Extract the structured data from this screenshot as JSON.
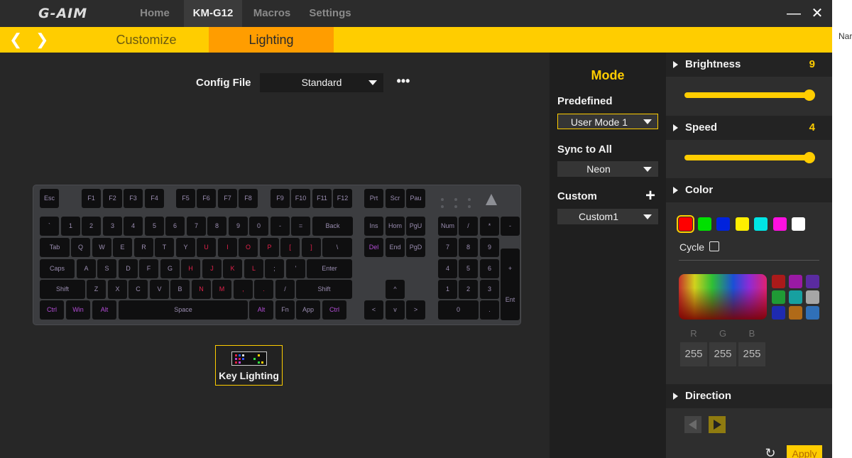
{
  "header": {
    "logo": "G-AIM",
    "nav": [
      {
        "label": "Home",
        "active": false
      },
      {
        "label": "KM-G12",
        "active": true
      },
      {
        "label": "Macros",
        "active": false
      },
      {
        "label": "Settings",
        "active": false
      }
    ],
    "minimize_glyph": "—",
    "close_glyph": "✕"
  },
  "tabbar": {
    "prev_glyph": "❮",
    "next_glyph": "❯",
    "tabs": [
      {
        "label": "Customize",
        "active": false
      },
      {
        "label": "Lighting",
        "active": true
      }
    ]
  },
  "config": {
    "label": "Config File",
    "value": "Standard",
    "more_glyph": "•••"
  },
  "keyboard": {
    "rows": [
      [
        "Esc",
        "F1",
        "F2",
        "F3",
        "F4",
        "F5",
        "F6",
        "F7",
        "F8",
        "F9",
        "F10",
        "F11",
        "F12",
        "Prt",
        "Scr",
        "Pau"
      ],
      [
        "`",
        "1",
        "2",
        "3",
        "4",
        "5",
        "6",
        "7",
        "8",
        "9",
        "0",
        "-",
        "=",
        "Back",
        "Ins",
        "Hom",
        "PgU",
        "Num",
        "/",
        "*",
        "-"
      ],
      [
        "Tab",
        "Q",
        "W",
        "E",
        "R",
        "T",
        "Y",
        "U",
        "I",
        "O",
        "P",
        "[",
        "]",
        "\\",
        "Del",
        "End",
        "PgD",
        "7",
        "8",
        "9",
        "+"
      ],
      [
        "Caps",
        "A",
        "S",
        "D",
        "F",
        "G",
        "H",
        "J",
        "K",
        "L",
        ";",
        "'",
        "Enter",
        "4",
        "5",
        "6"
      ],
      [
        "Shift",
        "Z",
        "X",
        "C",
        "V",
        "B",
        "N",
        "M",
        ",",
        ".",
        "/",
        "Shift",
        "^",
        "1",
        "2",
        "3",
        "Ent"
      ],
      [
        "Ctrl",
        "Win",
        "Alt",
        "Space",
        "Alt",
        "Fn",
        "App",
        "Ctrl",
        "<",
        "v",
        ">",
        "0",
        "."
      ]
    ]
  },
  "key_lighting": {
    "label": "Key Lighting"
  },
  "mode": {
    "title": "Mode",
    "predefined_label": "Predefined",
    "predefined_value": "User Mode 1",
    "sync_label": "Sync to All",
    "sync_value": "Neon",
    "custom_label": "Custom",
    "custom_value": "Custom1",
    "add_glyph": "+"
  },
  "settings": {
    "brightness": {
      "label": "Brightness",
      "value": "9",
      "level": 1.0
    },
    "speed": {
      "label": "Speed",
      "value": "4",
      "level": 1.0
    },
    "color": {
      "label": "Color",
      "swatches": [
        "#ff0000",
        "#00e000",
        "#0022dd",
        "#ffee00",
        "#00e5e5",
        "#ff10e0",
        "#ffffff"
      ],
      "selected_index": 0,
      "cycle_label": "Cycle",
      "presets": [
        "#aa1a1a",
        "#9a1aa4",
        "#5a2ba0",
        "#1f9a35",
        "#17a0a0",
        "#a6a6a6",
        "#1e2ab0",
        "#b06a18",
        "#3070b8"
      ],
      "rgb_labels": [
        "R",
        "G",
        "B"
      ],
      "rgb_values": [
        "255",
        "255",
        "255"
      ]
    },
    "direction": {
      "label": "Direction"
    },
    "reset_glyph": "↻",
    "apply_label": "Apply"
  },
  "outside": {
    "text": "Nar"
  },
  "colors": {
    "accent": "#ffcd00",
    "tab_active": "#ff9d00",
    "background": "#262626"
  }
}
